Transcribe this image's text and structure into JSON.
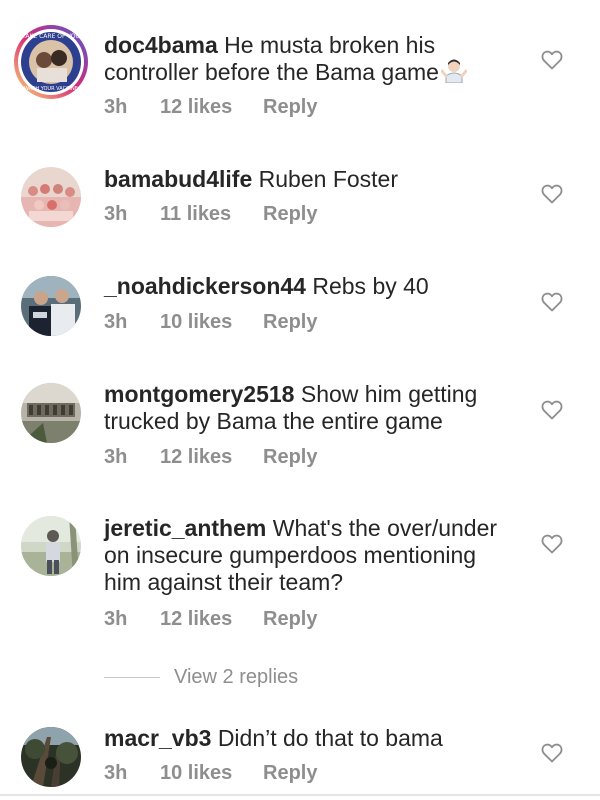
{
  "comments": [
    {
      "username": "doc4bama",
      "text": "He musta broken his controller before the Bama game",
      "emoji": "person-shrugging",
      "time": "3h",
      "likes": "12 likes",
      "reply": "Reply",
      "avatar": {
        "story_ring": true,
        "ring_text": [
          "TAKE CARE OF YOU",
          "WASH YOUR VACCINE"
        ]
      }
    },
    {
      "username": "bamabud4life",
      "text": "Ruben Foster",
      "time": "3h",
      "likes": "11 likes",
      "reply": "Reply",
      "avatar": {
        "story_ring": false
      }
    },
    {
      "username": "_noahdickerson44",
      "text": "Rebs by 40",
      "time": "3h",
      "likes": "10 likes",
      "reply": "Reply",
      "avatar": {
        "story_ring": false
      }
    },
    {
      "username": "montgomery2518",
      "text": "Show him getting trucked by Bama the entire game",
      "time": "3h",
      "likes": "12 likes",
      "reply": "Reply",
      "avatar": {
        "story_ring": false
      }
    },
    {
      "username": "jeretic_anthem",
      "text": "What's the over/under on insecure gumperdoos mentioning him against their team?",
      "time": "3h",
      "likes": "12 likes",
      "reply": "Reply",
      "avatar": {
        "story_ring": false
      }
    },
    {
      "username": "macr_vb3",
      "text": "Didn’t do that to bama",
      "time": "3h",
      "likes": "10 likes",
      "reply": "Reply",
      "avatar": {
        "story_ring": false
      }
    }
  ],
  "view_replies": "View 2 replies",
  "icons": {
    "like": "heart-outline-icon"
  },
  "colors": {
    "text": "#262626",
    "secondary": "#8e8e8e",
    "story_ring": [
      "#feda75",
      "#d62976",
      "#4f5bd5"
    ]
  }
}
